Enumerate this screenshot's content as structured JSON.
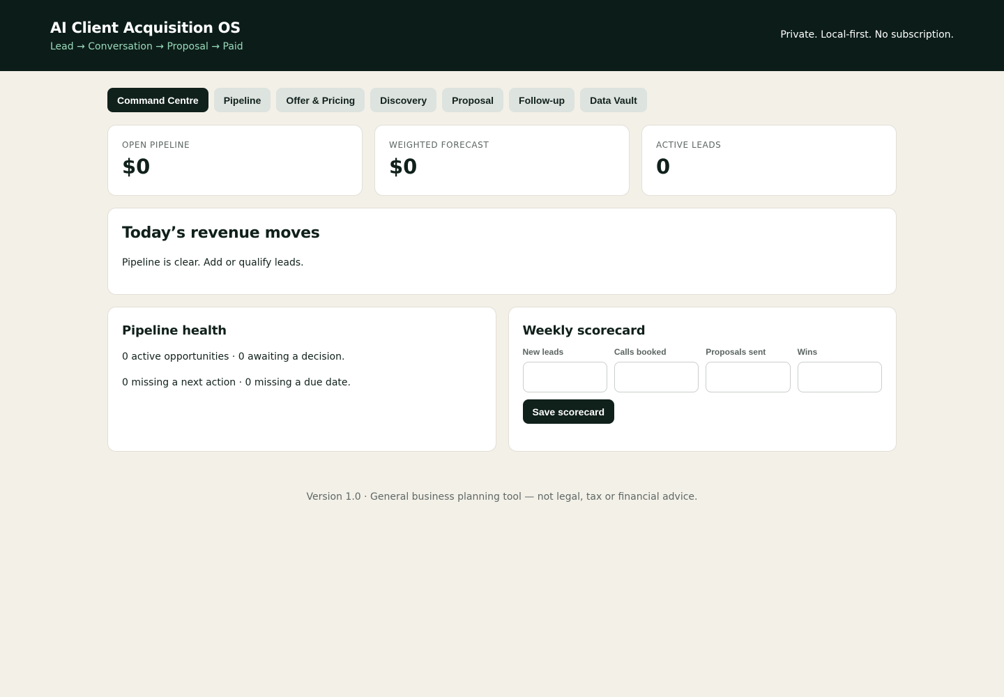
{
  "header": {
    "title": "AI Client Acquisition OS",
    "subtitle": "Lead → Conversation → Proposal → Paid",
    "note": "Private. Local-first. No subscription."
  },
  "tabs": [
    {
      "label": "Command Centre",
      "active": true
    },
    {
      "label": "Pipeline",
      "active": false
    },
    {
      "label": "Offer & Pricing",
      "active": false
    },
    {
      "label": "Discovery",
      "active": false
    },
    {
      "label": "Proposal",
      "active": false
    },
    {
      "label": "Follow-up",
      "active": false
    },
    {
      "label": "Data Vault",
      "active": false
    }
  ],
  "metrics": [
    {
      "label": "OPEN PIPELINE",
      "value": "$0"
    },
    {
      "label": "WEIGHTED FORECAST",
      "value": "$0"
    },
    {
      "label": "ACTIVE LEADS",
      "value": "0"
    }
  ],
  "revenue_moves": {
    "title": "Today’s revenue moves",
    "text": "Pipeline is clear. Add or qualify leads."
  },
  "pipeline_health": {
    "title": "Pipeline health",
    "line1": "0 active opportunities · 0 awaiting a decision.",
    "line2": "0 missing a next action · 0 missing a due date."
  },
  "scorecard": {
    "title": "Weekly scorecard",
    "fields": [
      {
        "label": "New leads",
        "value": ""
      },
      {
        "label": "Calls booked",
        "value": ""
      },
      {
        "label": "Proposals sent",
        "value": ""
      },
      {
        "label": "Wins",
        "value": ""
      }
    ],
    "save_label": "Save scorecard"
  },
  "footer": {
    "text": "Version 1.0 · General business planning tool — not legal, tax or financial advice."
  },
  "colors": {
    "header_bg": "#0c1d19",
    "page_bg": "#f3f0e8",
    "accent_text": "#9ad9bb",
    "primary_dark": "#10201b",
    "tab_bg": "#dde3df"
  }
}
